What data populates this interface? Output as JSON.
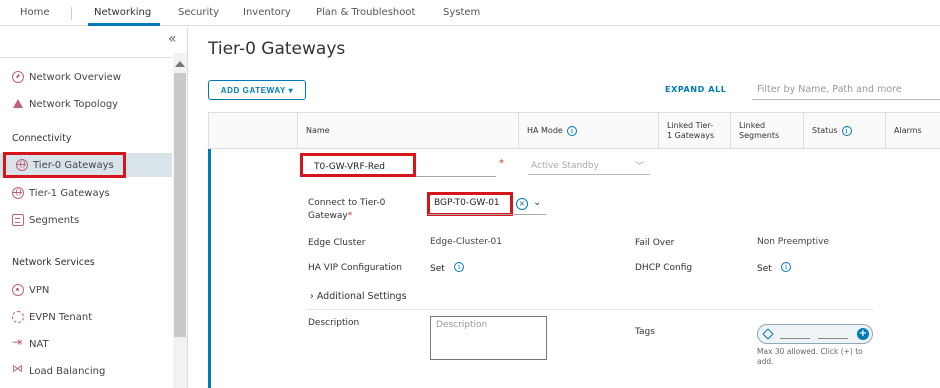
{
  "topnav": {
    "tabs": [
      "Home",
      "Networking",
      "Security",
      "Inventory",
      "Plan & Troubleshoot",
      "System"
    ],
    "active_tab": "Networking"
  },
  "sidebar": {
    "collapse_glyph": "«",
    "items_top": [
      {
        "label": "Network Overview",
        "icon": "gauge-icon"
      },
      {
        "label": "Network Topology",
        "icon": "topology-icon"
      }
    ],
    "section_connectivity": "Connectivity",
    "items_connectivity": [
      {
        "label": "Tier-0 Gateways",
        "icon": "globe-icon",
        "selected": true
      },
      {
        "label": "Tier-1 Gateways",
        "icon": "globe-icon"
      },
      {
        "label": "Segments",
        "icon": "segments-icon"
      }
    ],
    "section_services": "Network Services",
    "items_services": [
      {
        "label": "VPN",
        "icon": "vpn-icon"
      },
      {
        "label": "EVPN Tenant",
        "icon": "tenant-icon"
      },
      {
        "label": "NAT",
        "icon": "nat-icon"
      },
      {
        "label": "Load Balancing",
        "icon": "load-balancing-icon"
      }
    ]
  },
  "main": {
    "title": "Tier-0 Gateways",
    "add_button": "ADD GATEWAY ▾",
    "expand_all": "EXPAND ALL",
    "filter_placeholder": "Filter by Name, Path and more"
  },
  "grid": {
    "columns": {
      "name": "Name",
      "ha_mode": "HA Mode",
      "linked_tier1_l1": "Linked Tier-",
      "linked_tier1_l2": "1 Gateways",
      "linked_segments_l1": "Linked",
      "linked_segments_l2": "Segments",
      "status": "Status",
      "alarms": "Alarms"
    }
  },
  "form": {
    "name_value": "T0-GW-VRF-Red",
    "ha_mode_placeholder": "Active Standby",
    "connect_label_l1": "Connect to Tier-0",
    "connect_label_l2": "Gateway",
    "connect_value": "BGP-T0-GW-01",
    "edge_cluster_label": "Edge Cluster",
    "edge_cluster_value": "Edge-Cluster-01",
    "fail_over_label": "Fail Over",
    "fail_over_value": "Non Preemptive",
    "ha_vip_label": "HA VIP Configuration",
    "ha_vip_value": "Set",
    "dhcp_label": "DHCP Config",
    "dhcp_value": "Set",
    "additional_settings": "Additional Settings",
    "description_label": "Description",
    "description_placeholder": "Description",
    "tags_label": "Tags",
    "tags_hint": "Max 30 allowed. Click (+) to add."
  },
  "colors": {
    "accent": "#0079b8",
    "highlight_box": "#d4151c",
    "icon": "#c0627a"
  }
}
